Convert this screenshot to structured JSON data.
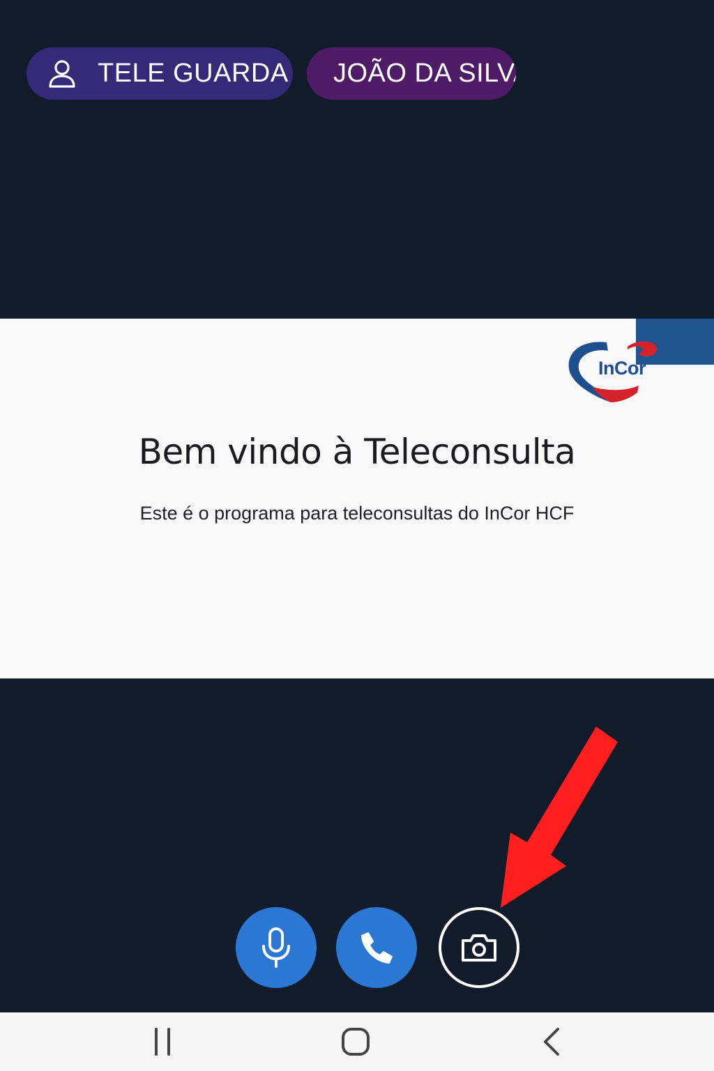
{
  "header": {
    "role_label": "TELE GUARDA",
    "role_icon": "person-icon",
    "user_name": "JOÃO DA SILVA"
  },
  "welcome": {
    "logo_text": "InCor",
    "title": "Bem vindo à Teleconsulta",
    "subtitle": "Este é o programa para teleconsultas do InCor HCF"
  },
  "controls": [
    {
      "icon": "microphone-icon",
      "color": "#2a78d4"
    },
    {
      "icon": "phone-icon",
      "color": "#2a78d4"
    },
    {
      "icon": "camera-icon",
      "color": "#ffffff"
    }
  ],
  "annotation": {
    "type": "arrow",
    "color": "#ff1f1f",
    "target": "camera-button"
  },
  "system_nav": {
    "recent_icon": "recent-apps-icon",
    "home_icon": "home-icon",
    "back_icon": "back-icon"
  },
  "colors": {
    "background": "#111b2a",
    "role_pill": "#342a78",
    "name_pill": "#4e1c67",
    "panel": "#f9f9f9",
    "brand_blue": "#1d4e8e",
    "brand_red": "#d2232a",
    "button_blue": "#2a78d4"
  }
}
